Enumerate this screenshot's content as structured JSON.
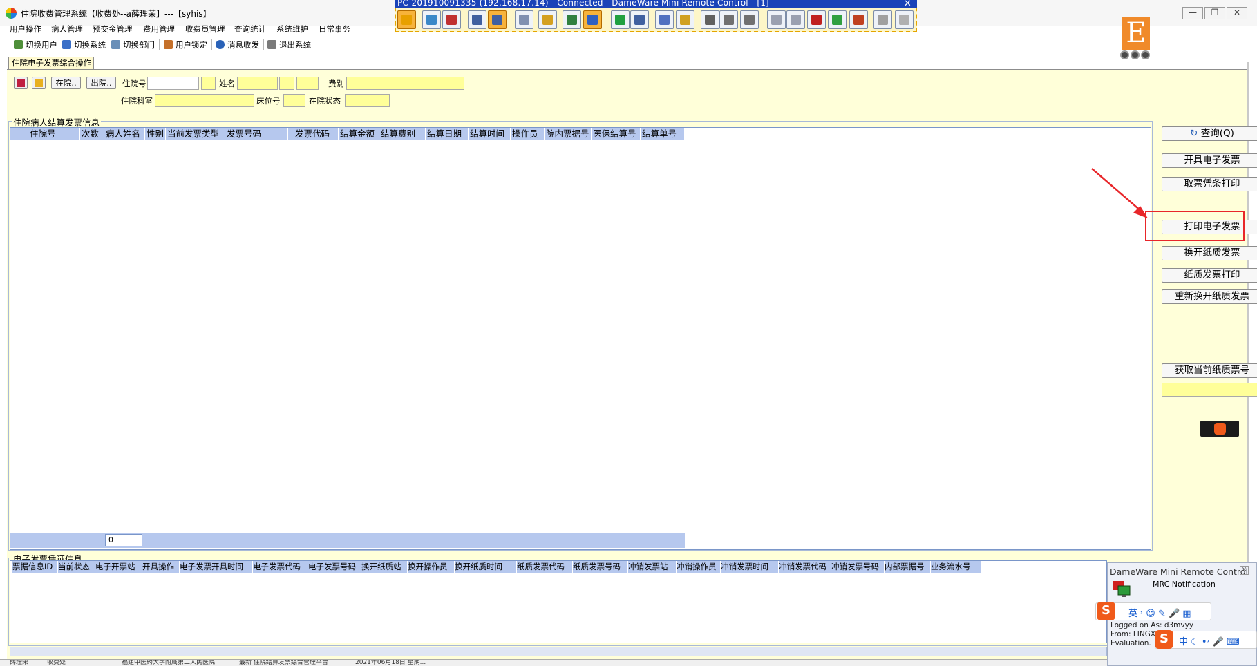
{
  "window": {
    "title": "住院收费管理系统【收费处--a薛理荣】---【syhis】",
    "min_glyph": "—",
    "max_glyph": "❐",
    "close_glyph": "✕"
  },
  "remote": {
    "title": "PC-201910091335 (192.168.17.14) - Connected - DameWare Mini Remote Control - [1]",
    "close_glyph": "✕",
    "tools": [
      "pin-tool",
      "monitor-tool",
      "disconnect-tool",
      "screen-tool",
      "move-tool",
      "text-tool",
      "lock-tool",
      "view-tool",
      "keyboard-tool",
      "pointer-tool",
      "select-tool",
      "grid-tool",
      "settings-tool",
      "capture-tool",
      "print-tool",
      "print2-tool",
      "copy-tool",
      "copy2-tool",
      "stop-tool",
      "transfer-tool",
      "transfer2-tool",
      "window-tool",
      "unlock-tool"
    ]
  },
  "menu": {
    "items": [
      "用户操作",
      "病人管理",
      "预交金管理",
      "费用管理",
      "收费员管理",
      "查询统计",
      "系统维护",
      "日常事务"
    ]
  },
  "toolbar": {
    "items": [
      "切换用户",
      "切换系统",
      "切换部门",
      "用户锁定",
      "消息收发",
      "退出系统"
    ]
  },
  "brand": {
    "letter": "E"
  },
  "tab": {
    "label": "住院电子发票综合操作"
  },
  "search": {
    "btn_in": "在院..",
    "btn_out": "出院..",
    "label_admission": "住院号",
    "label_name": "姓名",
    "label_fee_type": "费别",
    "label_dept": "住院科室",
    "label_bed": "床位号",
    "label_status": "在院状态"
  },
  "group1": {
    "title": "住院病人结算发票信息",
    "columns": [
      "住院号",
      "次数",
      "病人姓名",
      "性别",
      "当前发票类型",
      "发票号码",
      "发票代码",
      "结算金额",
      "结算费别",
      "结算日期",
      "结算时间",
      "操作员",
      "院内票据号",
      "医保结算号",
      "结算单号"
    ],
    "footer_count": "0"
  },
  "group2": {
    "title": "电子发票凭证信息",
    "columns": [
      "票据信息ID",
      "当前状态",
      "电子开票站",
      "开具操作",
      "电子发票开具时间",
      "电子发票代码",
      "电子发票号码",
      "换开纸质站",
      "换开操作员",
      "换开纸质时间",
      "纸质发票代码",
      "纸质发票号码",
      "冲销发票站",
      "冲销操作员",
      "冲销发票时间",
      "冲销发票代码",
      "冲销发票号码",
      "内部票据号",
      "业务流水号"
    ]
  },
  "actions": {
    "query": "查询(Q)",
    "issue": "开具电子发票",
    "receipt_print": "取票凭条打印",
    "print_einvoice": "打印电子发票",
    "swap_paper": "换开纸质发票",
    "paper_print": "纸质发票打印",
    "reswap_paper": "重新换开纸质发票",
    "get_paper_no": "获取当前纸质票号"
  },
  "statusbar": {
    "items": [
      "薛理荣",
      "收费处",
      "福建中医药大学附属第二人民医院",
      "最新 住院结算发票综合管理平台",
      "2021年06月18日 星期..."
    ]
  },
  "mrc": {
    "title": "DameWare Mini Remote Control",
    "close_glyph": "✕",
    "subtitle": "MRC Notification",
    "logged": "Logged on As: d3mvyy",
    "from": "From: LINGXIA",
    "evaluation": "Evaluation."
  },
  "ime": {
    "s_glyph": "S",
    "bar1": "英 ˒ ☺ ✎ 🎤 ▦",
    "bar2": "中 ☾ •˒ 🎤 ⌨"
  },
  "colors": {
    "panel_bg": "#ffffd9",
    "field_bg": "#ffff99",
    "grid_header": "#b6c8ee",
    "highlight": "#e8262a",
    "remote_title": "#1a43b8"
  }
}
